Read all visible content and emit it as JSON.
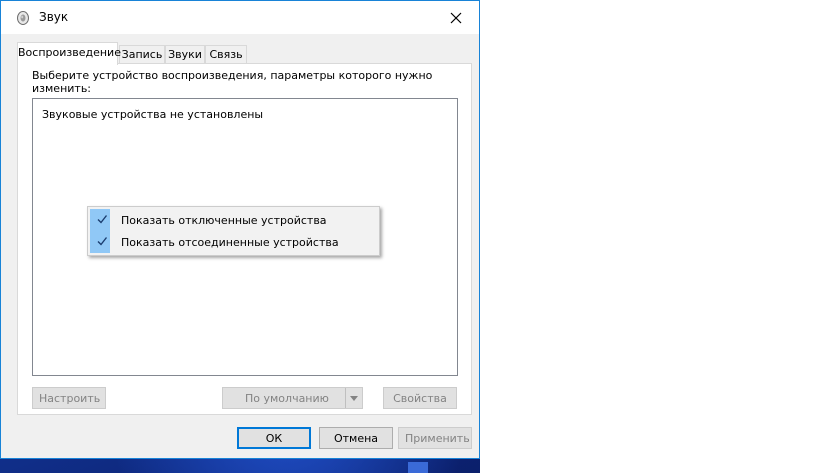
{
  "window": {
    "title": "Звук",
    "icon": "speaker-icon",
    "close_icon": "close-icon"
  },
  "tabs": [
    {
      "label": "Воспроизведение",
      "active": true
    },
    {
      "label": "Запись",
      "active": false
    },
    {
      "label": "Звуки",
      "active": false
    },
    {
      "label": "Связь",
      "active": false
    }
  ],
  "panel": {
    "instruction": "Выберите устройство воспроизведения, параметры которого нужно изменить:",
    "empty_message": "Звуковые устройства не установлены"
  },
  "context_menu": {
    "items": [
      {
        "label": "Показать отключенные устройства",
        "checked": true
      },
      {
        "label": "Показать отсоединенные устройства",
        "checked": true
      }
    ]
  },
  "panel_buttons": {
    "configure": "Настроить",
    "set_default": "По умолчанию",
    "properties": "Свойства"
  },
  "dialog_buttons": {
    "ok": "ОК",
    "cancel": "Отмена",
    "apply": "Применить"
  },
  "colors": {
    "accent": "#0078d7",
    "menu_check_bg": "#90c8f6",
    "disabled_text": "#838383"
  }
}
